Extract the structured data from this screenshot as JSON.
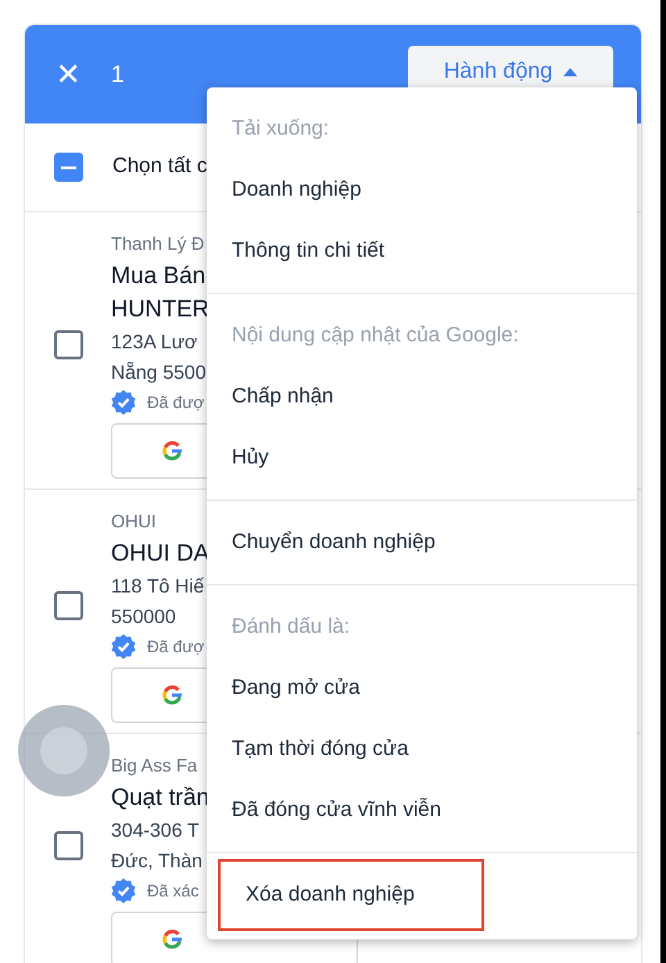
{
  "header": {
    "close_icon": "✕",
    "count": "1",
    "action_button": {
      "label": "Hành động",
      "expanded": true
    }
  },
  "select_all": {
    "label": "Chọn tất c",
    "indeterminate": true
  },
  "listings": [
    {
      "category": "Thanh Lý Đ",
      "name_lines": [
        "Mua Bán",
        "HUNTER"
      ],
      "address_lines": [
        "123A Lươ",
        "Nẵng 5500"
      ],
      "status": "Đã đượ",
      "checked": false
    },
    {
      "category": "OHUI",
      "name_lines": [
        "OHUI DA"
      ],
      "address_lines": [
        "118 Tô Hiế",
        "550000"
      ],
      "status": "Đã đượ",
      "checked": false
    },
    {
      "category": "Big Ass Fa",
      "name_lines": [
        "Quạt trần"
      ],
      "address_lines": [
        "304-306 T",
        "Đức, Thàn"
      ],
      "status": "Đã xác",
      "checked": false
    }
  ],
  "menu": {
    "sections": [
      {
        "items": [
          {
            "kind": "header",
            "label": "Tải xuống:",
            "highlighted": false
          },
          {
            "kind": "item",
            "label": "Doanh nghiệp",
            "highlighted": false
          },
          {
            "kind": "item",
            "label": "Thông tin chi tiết",
            "highlighted": false
          }
        ]
      },
      {
        "items": [
          {
            "kind": "header",
            "label": "Nội dung cập nhật của Google:",
            "highlighted": false
          },
          {
            "kind": "item",
            "label": "Chấp nhận",
            "highlighted": false
          },
          {
            "kind": "item",
            "label": "Hủy",
            "highlighted": false
          }
        ]
      },
      {
        "items": [
          {
            "kind": "item",
            "label": "Chuyển doanh nghiệp",
            "highlighted": false
          }
        ]
      },
      {
        "items": [
          {
            "kind": "header",
            "label": "Đánh dấu là:",
            "highlighted": false
          },
          {
            "kind": "item",
            "label": "Đang mở cửa",
            "highlighted": false
          },
          {
            "kind": "item",
            "label": "Tạm thời đóng cửa",
            "highlighted": false
          },
          {
            "kind": "item",
            "label": "Đã đóng cửa vĩnh viễn",
            "highlighted": false
          }
        ]
      },
      {
        "items": [
          {
            "kind": "item",
            "label": "Xóa doanh nghiệp",
            "highlighted": true
          }
        ]
      }
    ]
  }
}
